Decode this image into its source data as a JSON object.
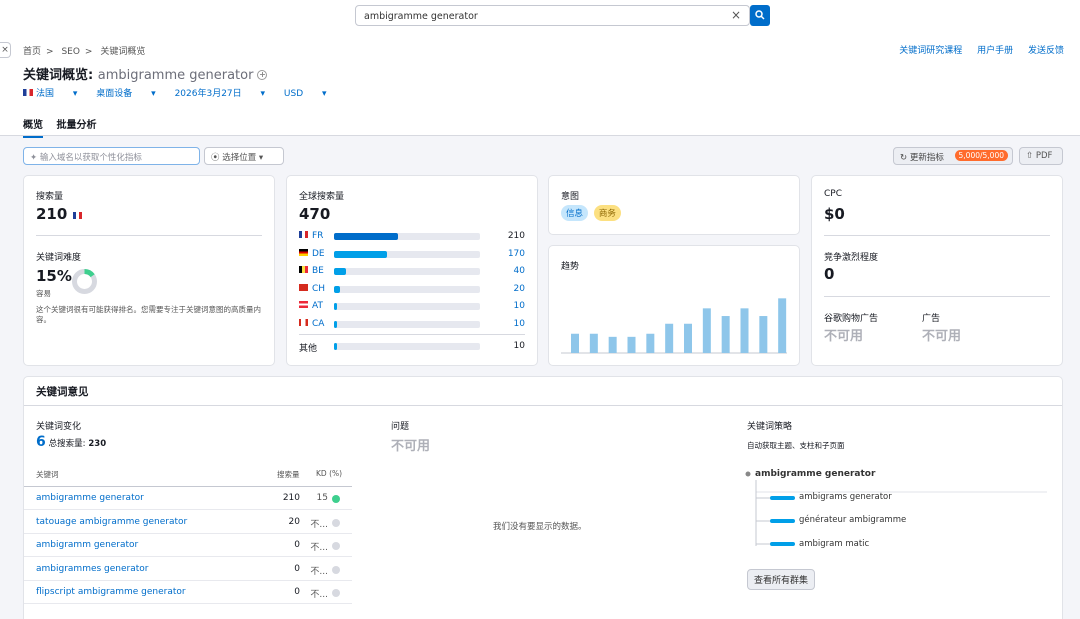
{
  "search": {
    "value": "ambigramme generator",
    "clear": "×"
  },
  "breadcrumb": [
    "首页",
    ">",
    "SEO",
    ">",
    "关键词概览"
  ],
  "top_links": [
    "关键词研究课程",
    "用户手册",
    "发送反馈"
  ],
  "page_title": {
    "prefix": "关键词概览:",
    "keyword": "ambigramme generator"
  },
  "filters": {
    "country": "法国",
    "device": "桌面设备",
    "date": "2026年3月27日",
    "currency": "USD"
  },
  "tabs": [
    "概览",
    "批量分析"
  ],
  "domain_input": {
    "placeholder": "输入域名以获取个性化指标"
  },
  "location": "选择位置",
  "update": {
    "label": "更新指标",
    "badge": "5,000/5,000"
  },
  "pdf": "PDF",
  "volume": {
    "label": "搜索量",
    "value": "210"
  },
  "difficulty": {
    "label": "关键词难度",
    "value": "15%",
    "level": "容易",
    "percent": 15,
    "desc": "这个关键词很有可能获得排名。您需要专注于关键词意图的高质量内容。"
  },
  "global": {
    "label": "全球搜索量",
    "value": "470",
    "rows": [
      {
        "code": "FR",
        "value": "210",
        "share": 0.44,
        "flag": "fr",
        "bar": "#006dca"
      },
      {
        "code": "DE",
        "value": "170",
        "share": 0.36,
        "flag": "de",
        "bar": "#009fe8"
      },
      {
        "code": "BE",
        "value": "40",
        "share": 0.08,
        "flag": "be",
        "bar": "#009fe8"
      },
      {
        "code": "CH",
        "value": "20",
        "share": 0.04,
        "flag": "ch",
        "bar": "#009fe8"
      },
      {
        "code": "AT",
        "value": "10",
        "share": 0.02,
        "flag": "at",
        "bar": "#009fe8"
      },
      {
        "code": "CA",
        "value": "10",
        "share": 0.02,
        "flag": "ca",
        "bar": "#009fe8"
      }
    ],
    "other": {
      "label": "其他",
      "value": "10",
      "share": 0.02
    }
  },
  "intent": {
    "label": "意图",
    "tags": [
      "信息",
      "商务"
    ]
  },
  "trend": {
    "label": "趋势"
  },
  "chart_data": {
    "type": "bar",
    "values": [
      0.25,
      0.25,
      0.21,
      0.21,
      0.25,
      0.38,
      0.38,
      0.58,
      0.48,
      0.58,
      0.48,
      0.71
    ]
  },
  "cpc": {
    "label": "CPC",
    "value": "$0"
  },
  "competition": {
    "label": "竞争激烈程度",
    "value": "0"
  },
  "shopping": {
    "label": "谷歌购物广告",
    "value": "不可用"
  },
  "ads": {
    "label": "广告",
    "value": "不可用"
  },
  "ideas": {
    "title": "关键词意见",
    "variations": {
      "label": "关键词变化",
      "count": "6",
      "total_label": "总搜索量:",
      "total": "230"
    },
    "table_headers": {
      "keyword": "关键词",
      "volume": "搜索量",
      "kd": "KD (%)"
    },
    "rows": [
      {
        "keyword": "ambigramme generator",
        "volume": "210",
        "kd": "15",
        "dot": "#3ecf8e"
      },
      {
        "keyword": "tatouage ambigramme generator",
        "volume": "20",
        "kd": "不...",
        "dot": "#d7d9e0"
      },
      {
        "keyword": "ambigramm generator",
        "volume": "0",
        "kd": "不...",
        "dot": "#d7d9e0"
      },
      {
        "keyword": "ambigrammes generator",
        "volume": "0",
        "kd": "不...",
        "dot": "#d7d9e0"
      },
      {
        "keyword": "flipscript ambigramme generator",
        "volume": "0",
        "kd": "不...",
        "dot": "#d7d9e0"
      }
    ],
    "questions": {
      "label": "问题",
      "value": "不可用",
      "empty": "我们没有要显示的数据。"
    },
    "strategy": {
      "label": "关键词策略",
      "desc": "自动获取主题、支柱和子页面",
      "root": "ambigramme generator",
      "children": [
        "ambigrams generator",
        "générateur ambigramme",
        "ambigram matic"
      ],
      "button": "查看所有群集"
    }
  }
}
